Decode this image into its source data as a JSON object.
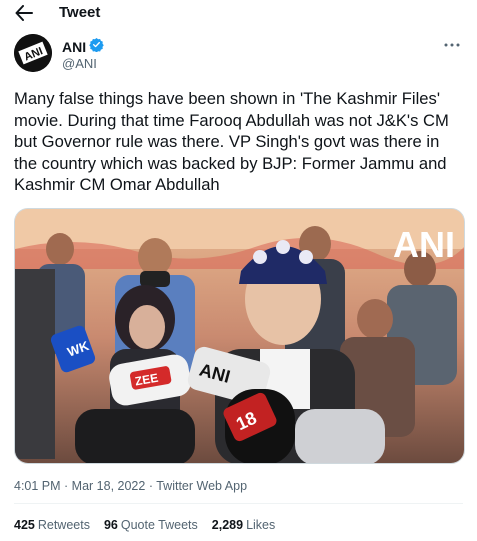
{
  "header": {
    "title": "Tweet"
  },
  "author": {
    "name": "ANI",
    "handle": "@ANI",
    "avatar_text": "ANI"
  },
  "tweet": {
    "text": "Many false things have been shown in 'The Kashmir Files' movie. During that time Farooq Abdullah was not J&K's CM but Governor rule was there. VP Singh's govt was there in the country which was backed by BJP: Former Jammu and Kashmir CM Omar Abdullah",
    "media_watermark": "ANI",
    "mic_labels": {
      "ani": "ANI",
      "zee": "ZEE",
      "ch18": "18",
      "wk": "WK"
    }
  },
  "meta": {
    "time": "4:01 PM",
    "sep1": " · ",
    "date": "Mar 18, 2022",
    "sep2": " · ",
    "source": "Twitter Web App"
  },
  "stats": {
    "retweets_count": "425",
    "retweets_label": "Retweets",
    "quotes_count": "96",
    "quotes_label": "Quote Tweets",
    "likes_count": "2,289",
    "likes_label": "Likes"
  },
  "colors": {
    "accent": "#1d9bf0",
    "verified": "#1d9bf0",
    "muted": "#536471"
  }
}
